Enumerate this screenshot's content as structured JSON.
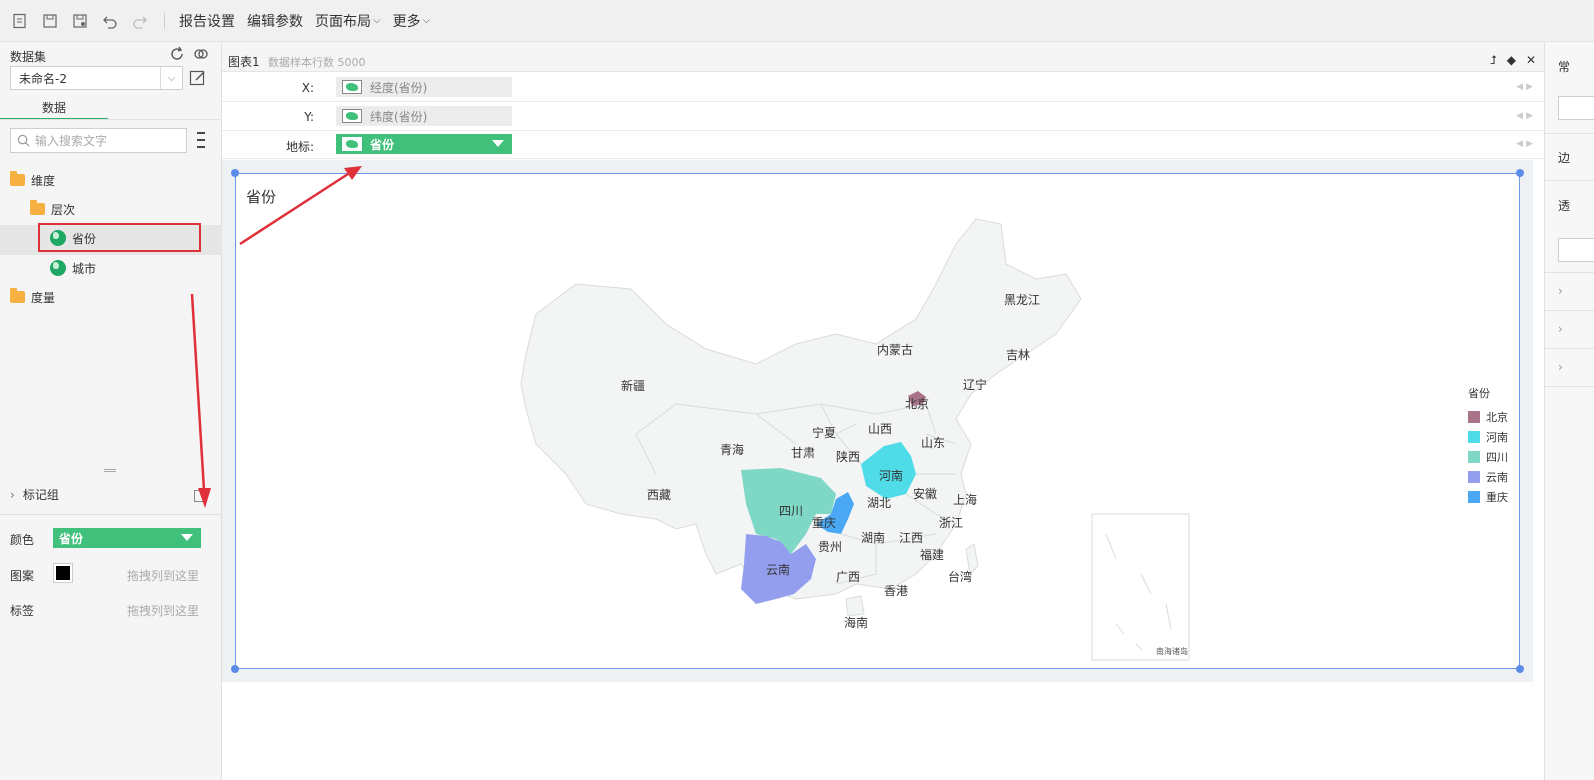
{
  "toolbar": {
    "menus": [
      "报告设置",
      "编辑参数",
      "页面布局",
      "更多"
    ]
  },
  "left_panel": {
    "dataset_label": "数据集",
    "dataset_value": "未命名-2",
    "tab_data": "数据",
    "search_placeholder": "输入搜索文字",
    "tree": {
      "dimension": "维度",
      "hierarchy": "层次",
      "province": "省份",
      "city": "城市",
      "measure": "度量"
    },
    "mark_group": "标记组",
    "props": {
      "color_label": "颜色",
      "color_value": "省份",
      "pattern_label": "图案",
      "pattern_hint": "拖拽列到这里",
      "tag_label": "标签",
      "tag_hint": "拖拽列到这里"
    }
  },
  "chart_header": {
    "name": "图表1",
    "sample": "数据样本行数 5000"
  },
  "shelves": [
    {
      "label": "X:",
      "value": "经度(省份)"
    },
    {
      "label": "Y:",
      "value": "纬度(省份)"
    },
    {
      "label": "地标:",
      "value": "省份"
    }
  ],
  "map": {
    "title": "省份",
    "labels": [
      "新疆",
      "西藏",
      "青海",
      "甘肃",
      "宁夏",
      "内蒙古",
      "黑龙江",
      "吉林",
      "辽宁",
      "北京",
      "山西",
      "陕西",
      "山东",
      "河南",
      "安徽",
      "湖北",
      "四川",
      "重庆",
      "上海",
      "浙江",
      "江西",
      "湖南",
      "贵州",
      "云南",
      "广西",
      "福建",
      "台湾",
      "香港",
      "海南"
    ],
    "inset_label": "南海诸岛"
  },
  "legend": {
    "title": "省份",
    "items": [
      {
        "name": "北京",
        "color": "#a9738a"
      },
      {
        "name": "河南",
        "color": "#4fdbe8"
      },
      {
        "name": "四川",
        "color": "#7fd8c6"
      },
      {
        "name": "云南",
        "color": "#939fee"
      },
      {
        "name": "重庆",
        "color": "#4aa8f4"
      }
    ]
  },
  "right_panel": {
    "items": [
      "常",
      "边",
      "透"
    ]
  }
}
